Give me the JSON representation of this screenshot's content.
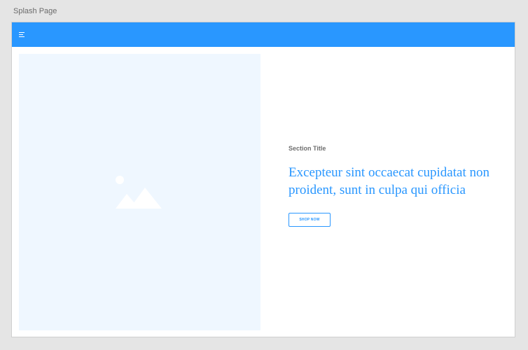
{
  "canvas": {
    "label": "Splash Page"
  },
  "header": {
    "menu_icon": "hamburger-menu-icon",
    "background_color": "#2997ff"
  },
  "hero": {
    "image_placeholder_icon": "image-placeholder-icon",
    "background_color": "#eff7ff"
  },
  "content": {
    "section_title": "Section Title",
    "headline": "Excepteur sint occaecat cupidatat non proident, sunt in culpa qui officia",
    "cta_label": "SHOP NOW",
    "accent_color": "#2997ff"
  }
}
